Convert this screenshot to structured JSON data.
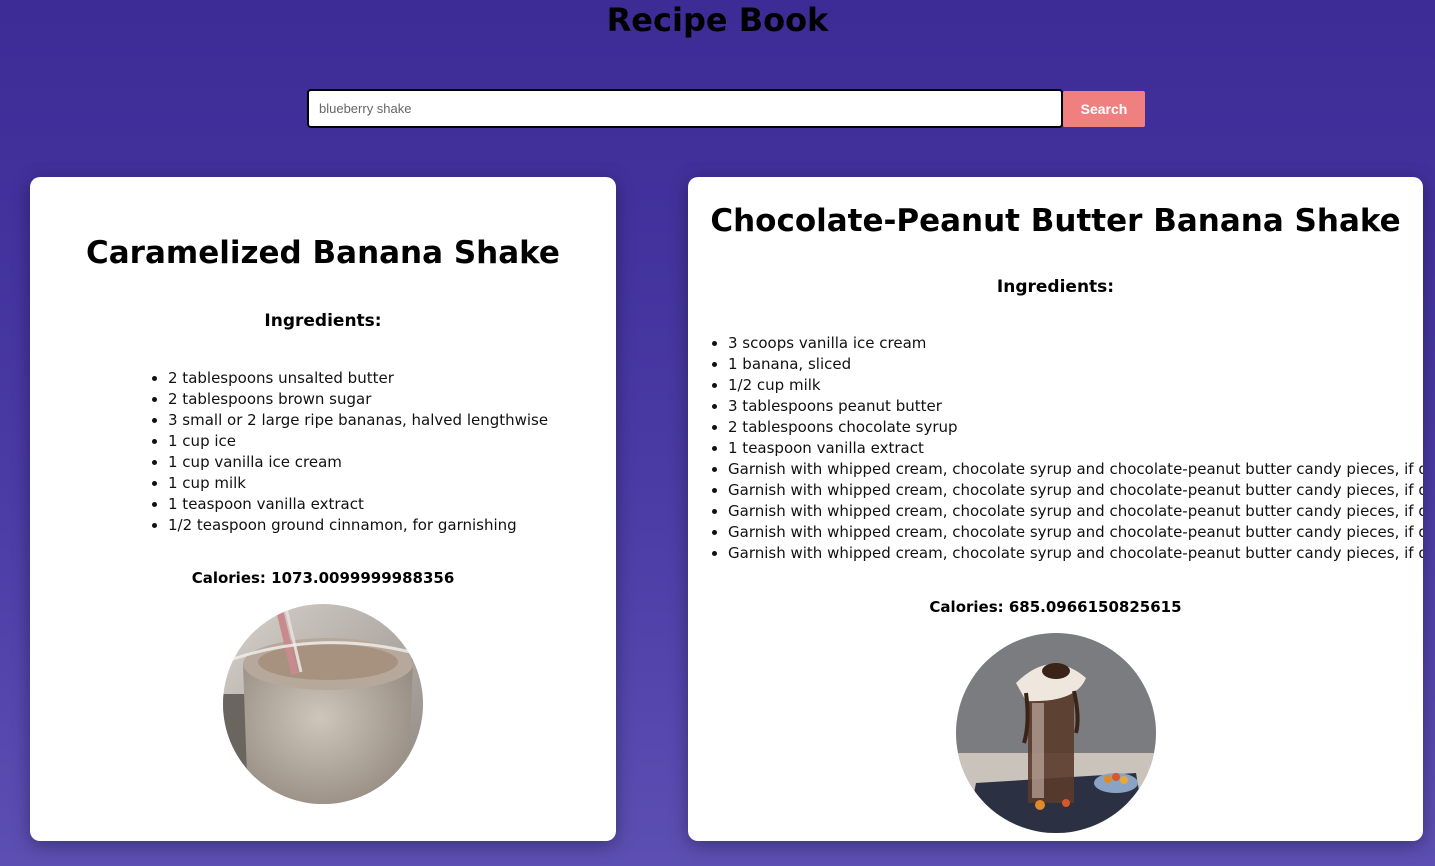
{
  "header": {
    "title": "Recipe Book"
  },
  "search": {
    "placeholder": "blueberry shake",
    "button_label": "Search"
  },
  "recipes": [
    {
      "title": "Caramelized Banana Shake",
      "ingredients_heading": "Ingredients:",
      "ingredients": [
        "2 tablespoons unsalted butter",
        "2 tablespoons brown sugar",
        "3 small or 2 large ripe bananas, halved lengthwise",
        "1 cup ice",
        "1 cup vanilla ice cream",
        "1 cup milk",
        "1 teaspoon vanilla extract",
        "1/2 teaspoon ground cinnamon, for garnishing"
      ],
      "calories": "Calories: 1073.0099999988356",
      "image_icon": "milkshake-photo"
    },
    {
      "title": "Chocolate-Peanut Butter Banana Shake",
      "ingredients_heading": "Ingredients:",
      "ingredients": [
        "3 scoops vanilla ice cream",
        "1 banana, sliced",
        "1/2 cup milk",
        "3 tablespoons peanut butter",
        "2 tablespoons chocolate syrup",
        "1 teaspoon vanilla extract",
        "Garnish with whipped cream, chocolate syrup and chocolate-peanut butter candy pieces, if desired",
        "Garnish with whipped cream, chocolate syrup and chocolate-peanut butter candy pieces, if desired",
        "Garnish with whipped cream, chocolate syrup and chocolate-peanut butter candy pieces, if desired",
        "Garnish with whipped cream, chocolate syrup and chocolate-peanut butter candy pieces, if desired",
        "Garnish with whipped cream, chocolate syrup and chocolate-peanut butter candy pieces, if desired"
      ],
      "calories": "Calories: 685.0966150825615",
      "image_icon": "chocolate-milkshake-photo"
    }
  ],
  "colors": {
    "background_top": "#3d2b96",
    "background_bottom": "#5c4fb3",
    "search_button": "#f08080",
    "card": "#ffffff"
  }
}
